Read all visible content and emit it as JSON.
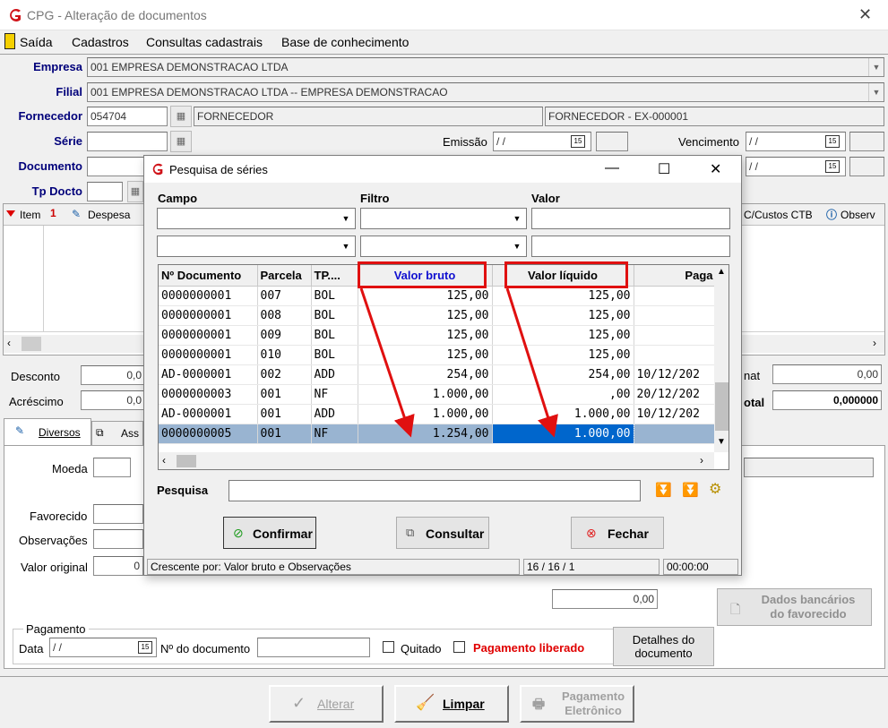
{
  "window": {
    "title": "CPG - Alteração de documentos"
  },
  "menu": [
    "Saída",
    "Cadastros",
    "Consultas cadastrais",
    "Base de conhecimento"
  ],
  "form": {
    "empresa_label": "Empresa",
    "empresa_value": "001 EMPRESA DEMONSTRACAO LTDA",
    "filial_label": "Filial",
    "filial_value": "001 EMPRESA DEMONSTRACAO LTDA -- EMPRESA DEMONSTRACAO",
    "fornecedor_label": "Fornecedor",
    "fornecedor_code": "054704",
    "fornecedor_name": "FORNECEDOR",
    "fornecedor_desc": "FORNECEDOR - EX-000001",
    "serie_label": "Série",
    "emissao_label": "Emissão",
    "emissao_value": " / /",
    "vencimento_label": "Vencimento",
    "vencimento_value": " / /",
    "documento_label": "Documento",
    "doc_date_value": " / /",
    "tpdocto_label": "Tp Docto"
  },
  "grid": {
    "col_item": "Item",
    "col_despesa": "Despesa",
    "col_ccustos": "C/Custos CTB",
    "col_observ": "Observ"
  },
  "totals": {
    "desconto_label": "Desconto",
    "desconto_value": "0,0",
    "acrescimo_label": "Acréscimo",
    "acrescimo_value": "0,0",
    "nat_label": "nat",
    "nat_value": "0,00",
    "total_label": "otal",
    "total_value": "0,000000"
  },
  "tabs": {
    "diversos": "Diversos",
    "ass": "Ass"
  },
  "details": {
    "moeda_label": "Moeda",
    "favorecido_label": "Favorecido",
    "observacoes_label": "Observações",
    "valor_original_label": "Valor original",
    "valor_original_value": "0",
    "valor_field": "0,00",
    "dados_bancarios": "Dados bancários\ndo favorecido",
    "pagamento_group": "Pagamento",
    "data_label": "Data",
    "data_value": " / /",
    "ndoc_label": "Nº do documento",
    "quitado_label": "Quitado",
    "pag_liberado_label": "Pagamento liberado",
    "detalhes_btn": "Detalhes do\ndocumento"
  },
  "bottom_buttons": {
    "alterar": "Alterar",
    "limpar": "Limpar",
    "pag_eletronico": "Pagamento\nEletrônico"
  },
  "dialog": {
    "title": "Pesquisa de séries",
    "campo_label": "Campo",
    "filtro_label": "Filtro",
    "valor_label": "Valor",
    "columns": [
      "Nº Documento",
      "Parcela",
      "TP....",
      "Valor bruto",
      "Valor líquido",
      "Paga"
    ],
    "rows": [
      [
        "0000000001",
        "007",
        "BOL",
        "125,00",
        "125,00",
        ""
      ],
      [
        "0000000001",
        "008",
        "BOL",
        "125,00",
        "125,00",
        ""
      ],
      [
        "0000000001",
        "009",
        "BOL",
        "125,00",
        "125,00",
        ""
      ],
      [
        "0000000001",
        "010",
        "BOL",
        "125,00",
        "125,00",
        ""
      ],
      [
        "AD-0000001",
        "002",
        "ADD",
        "254,00",
        "254,00",
        "10/12/202"
      ],
      [
        "0000000003",
        "001",
        "NF",
        "1.000,00",
        ",00",
        "20/12/202"
      ],
      [
        "AD-0000001",
        "001",
        "ADD",
        "1.000,00",
        "1.000,00",
        "10/12/202"
      ],
      [
        "0000000005",
        "001",
        "NF",
        "1.254,00",
        "1.000,00",
        ""
      ]
    ],
    "pesquisa_label": "Pesquisa",
    "btn_confirmar": "Confirmar",
    "btn_consultar": "Consultar",
    "btn_fechar": "Fechar",
    "status_sort": "Crescente por: Valor bruto e Observações",
    "status_count": "16 / 16 / 1",
    "status_time": "00:00:00"
  }
}
